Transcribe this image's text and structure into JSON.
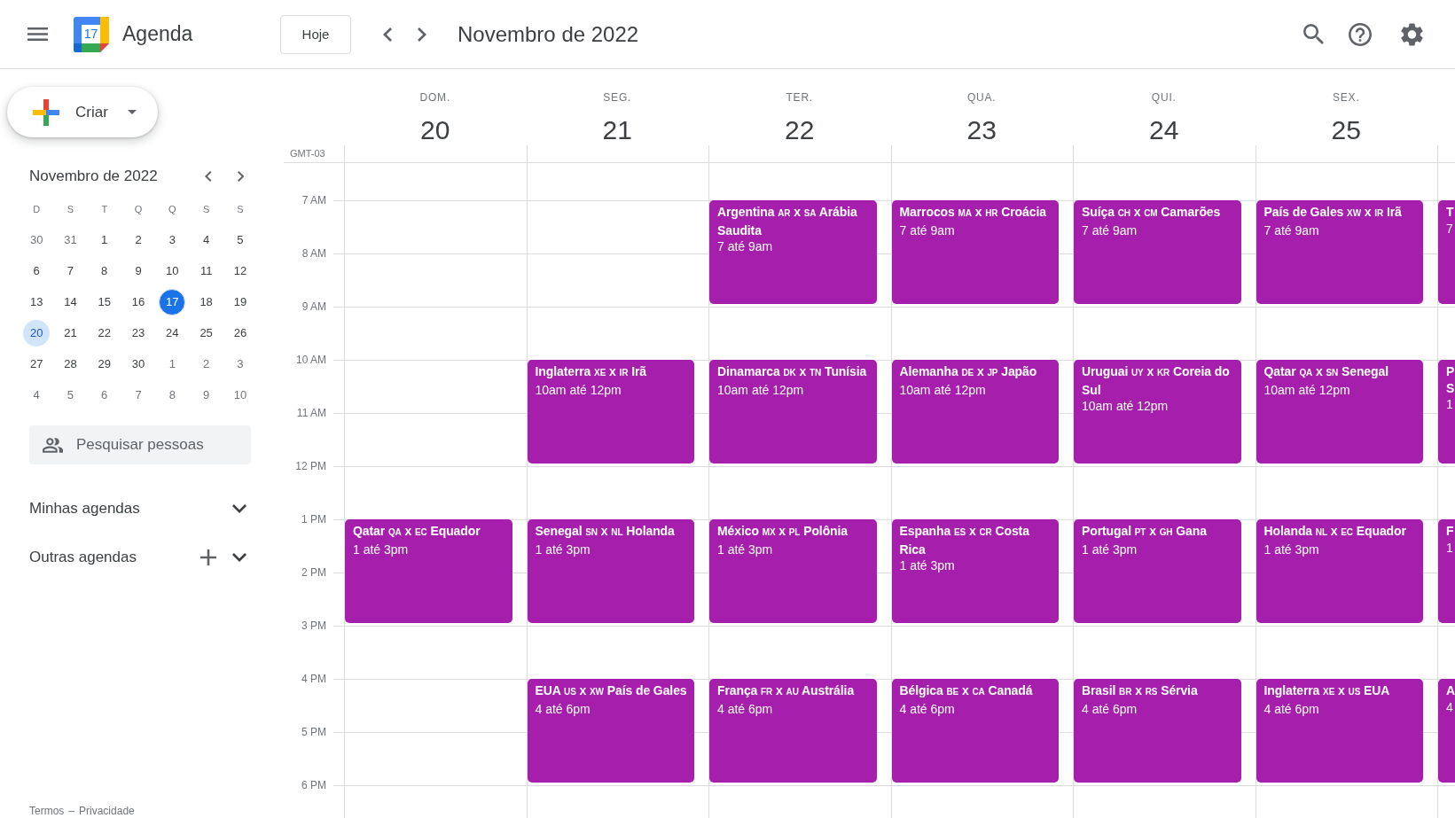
{
  "top_bar": {
    "app": {
      "logo_text": "17",
      "name": "Agenda"
    },
    "today_button": "Hoje",
    "title": "Novembro de 2022"
  },
  "sidebar": {
    "create_button": "Criar",
    "mini_calendar": {
      "title": "Novembro de 2022",
      "weekdays": [
        "D",
        "S",
        "T",
        "Q",
        "Q",
        "S",
        "S"
      ],
      "weeks": [
        [
          {
            "label": "30",
            "outside_month": true,
            "today": false,
            "selected": false
          },
          {
            "label": "31",
            "outside_month": true,
            "today": false,
            "selected": false
          },
          {
            "label": "1",
            "outside_month": false,
            "today": false,
            "selected": false
          },
          {
            "label": "2",
            "outside_month": false,
            "today": false,
            "selected": false
          },
          {
            "label": "3",
            "outside_month": false,
            "today": false,
            "selected": false
          },
          {
            "label": "4",
            "outside_month": false,
            "today": false,
            "selected": false
          },
          {
            "label": "5",
            "outside_month": false,
            "today": false,
            "selected": false
          }
        ],
        [
          {
            "label": "6",
            "outside_month": false,
            "today": false,
            "selected": false
          },
          {
            "label": "7",
            "outside_month": false,
            "today": false,
            "selected": false
          },
          {
            "label": "8",
            "outside_month": false,
            "today": false,
            "selected": false
          },
          {
            "label": "9",
            "outside_month": false,
            "today": false,
            "selected": false
          },
          {
            "label": "10",
            "outside_month": false,
            "today": false,
            "selected": false
          },
          {
            "label": "11",
            "outside_month": false,
            "today": false,
            "selected": false
          },
          {
            "label": "12",
            "outside_month": false,
            "today": false,
            "selected": false
          }
        ],
        [
          {
            "label": "13",
            "outside_month": false,
            "today": false,
            "selected": false
          },
          {
            "label": "14",
            "outside_month": false,
            "today": false,
            "selected": false
          },
          {
            "label": "15",
            "outside_month": false,
            "today": false,
            "selected": false
          },
          {
            "label": "16",
            "outside_month": false,
            "today": false,
            "selected": false
          },
          {
            "label": "17",
            "outside_month": false,
            "today": true,
            "selected": false
          },
          {
            "label": "18",
            "outside_month": false,
            "today": false,
            "selected": false
          },
          {
            "label": "19",
            "outside_month": false,
            "today": false,
            "selected": false
          }
        ],
        [
          {
            "label": "20",
            "outside_month": false,
            "today": false,
            "selected": true
          },
          {
            "label": "21",
            "outside_month": false,
            "today": false,
            "selected": false
          },
          {
            "label": "22",
            "outside_month": false,
            "today": false,
            "selected": false
          },
          {
            "label": "23",
            "outside_month": false,
            "today": false,
            "selected": false
          },
          {
            "label": "24",
            "outside_month": false,
            "today": false,
            "selected": false
          },
          {
            "label": "25",
            "outside_month": false,
            "today": false,
            "selected": false
          },
          {
            "label": "26",
            "outside_month": false,
            "today": false,
            "selected": false
          }
        ],
        [
          {
            "label": "27",
            "outside_month": false,
            "today": false,
            "selected": false
          },
          {
            "label": "28",
            "outside_month": false,
            "today": false,
            "selected": false
          },
          {
            "label": "29",
            "outside_month": false,
            "today": false,
            "selected": false
          },
          {
            "label": "30",
            "outside_month": false,
            "today": false,
            "selected": false
          },
          {
            "label": "1",
            "outside_month": true,
            "today": false,
            "selected": false
          },
          {
            "label": "2",
            "outside_month": true,
            "today": false,
            "selected": false
          },
          {
            "label": "3",
            "outside_month": true,
            "today": false,
            "selected": false
          }
        ],
        [
          {
            "label": "4",
            "outside_month": true,
            "today": false,
            "selected": false
          },
          {
            "label": "5",
            "outside_month": true,
            "today": false,
            "selected": false
          },
          {
            "label": "6",
            "outside_month": true,
            "today": false,
            "selected": false
          },
          {
            "label": "7",
            "outside_month": true,
            "today": false,
            "selected": false
          },
          {
            "label": "8",
            "outside_month": true,
            "today": false,
            "selected": false
          },
          {
            "label": "9",
            "outside_month": true,
            "today": false,
            "selected": false
          },
          {
            "label": "10",
            "outside_month": true,
            "today": false,
            "selected": false
          }
        ]
      ]
    },
    "people_search": {
      "placeholder": "Pesquisar pessoas"
    },
    "calendar_sections": [
      {
        "label": "Minhas agendas",
        "kind": "plain",
        "expanded": false
      },
      {
        "label": "Outras agendas",
        "kind": "addable",
        "expanded": false
      }
    ],
    "footer": {
      "links": [
        "Termos",
        "Privacidade"
      ],
      "separator": "–"
    }
  },
  "week_view": {
    "timezone": "GMT-03",
    "hours": [
      "7 AM",
      "8 AM",
      "9 AM",
      "10 AM",
      "11 AM",
      "12 PM",
      "1 PM",
      "2 PM",
      "3 PM",
      "4 PM",
      "5 PM",
      "6 PM"
    ],
    "days": [
      {
        "name": "DOM.",
        "number": "20",
        "events": [
          {
            "kind": "free"
          },
          {
            "kind": "free"
          },
          {
            "kind": "match",
            "title": [
              {
                "kind": "team",
                "text": "Qatar"
              },
              {
                "kind": "code",
                "text": "QA"
              },
              {
                "kind": "team",
                "text": "x"
              },
              {
                "kind": "code",
                "text": "EC"
              },
              {
                "kind": "team",
                "text": "Equador"
              }
            ],
            "time": "1 até 3pm"
          },
          {
            "kind": "free"
          }
        ]
      },
      {
        "name": "SEG.",
        "number": "21",
        "events": [
          {
            "kind": "free"
          },
          {
            "kind": "match",
            "title": [
              {
                "kind": "team",
                "text": "Inglaterra"
              },
              {
                "kind": "code",
                "text": "XE"
              },
              {
                "kind": "team",
                "text": "x"
              },
              {
                "kind": "code",
                "text": "IR"
              },
              {
                "kind": "team",
                "text": "Irã"
              }
            ],
            "time": "10am até 12pm"
          },
          {
            "kind": "match",
            "title": [
              {
                "kind": "team",
                "text": "Senegal"
              },
              {
                "kind": "code",
                "text": "SN"
              },
              {
                "kind": "team",
                "text": "x"
              },
              {
                "kind": "code",
                "text": "NL"
              },
              {
                "kind": "team",
                "text": "Holanda"
              }
            ],
            "time": "1 até 3pm"
          },
          {
            "kind": "match",
            "title": [
              {
                "kind": "team",
                "text": "EUA"
              },
              {
                "kind": "code",
                "text": "US"
              },
              {
                "kind": "team",
                "text": "x"
              },
              {
                "kind": "code",
                "text": "XW"
              },
              {
                "kind": "team",
                "text": "País de Gales"
              }
            ],
            "time": "4 até 6pm"
          }
        ]
      },
      {
        "name": "TER.",
        "number": "22",
        "events": [
          {
            "kind": "match",
            "title": [
              {
                "kind": "team",
                "text": "Argentina"
              },
              {
                "kind": "code",
                "text": "AR"
              },
              {
                "kind": "team",
                "text": "x"
              },
              {
                "kind": "code",
                "text": "SA"
              },
              {
                "kind": "team",
                "text": "Arábia Saudita"
              }
            ],
            "time": "7 até 9am"
          },
          {
            "kind": "match",
            "title": [
              {
                "kind": "team",
                "text": "Dinamarca"
              },
              {
                "kind": "code",
                "text": "DK"
              },
              {
                "kind": "team",
                "text": "x"
              },
              {
                "kind": "code",
                "text": "TN"
              },
              {
                "kind": "team",
                "text": "Tunísia"
              }
            ],
            "time": "10am até 12pm"
          },
          {
            "kind": "match",
            "title": [
              {
                "kind": "team",
                "text": "México"
              },
              {
                "kind": "code",
                "text": "MX"
              },
              {
                "kind": "team",
                "text": "x"
              },
              {
                "kind": "code",
                "text": "PL"
              },
              {
                "kind": "team",
                "text": "Polônia"
              }
            ],
            "time": "1 até 3pm"
          },
          {
            "kind": "match",
            "title": [
              {
                "kind": "team",
                "text": "França"
              },
              {
                "kind": "code",
                "text": "FR"
              },
              {
                "kind": "team",
                "text": "x"
              },
              {
                "kind": "code",
                "text": "AU"
              },
              {
                "kind": "team",
                "text": "Austrália"
              }
            ],
            "time": "4 até 6pm"
          }
        ]
      },
      {
        "name": "QUA.",
        "number": "23",
        "events": [
          {
            "kind": "match",
            "title": [
              {
                "kind": "team",
                "text": "Marrocos"
              },
              {
                "kind": "code",
                "text": "MA"
              },
              {
                "kind": "team",
                "text": "x"
              },
              {
                "kind": "code",
                "text": "HR"
              },
              {
                "kind": "team",
                "text": "Croácia"
              }
            ],
            "time": "7 até 9am"
          },
          {
            "kind": "match",
            "title": [
              {
                "kind": "team",
                "text": "Alemanha"
              },
              {
                "kind": "code",
                "text": "DE"
              },
              {
                "kind": "team",
                "text": "x"
              },
              {
                "kind": "code",
                "text": "JP"
              },
              {
                "kind": "team",
                "text": "Japão"
              }
            ],
            "time": "10am até 12pm"
          },
          {
            "kind": "match",
            "title": [
              {
                "kind": "team",
                "text": "Espanha"
              },
              {
                "kind": "code",
                "text": "ES"
              },
              {
                "kind": "team",
                "text": "x"
              },
              {
                "kind": "code",
                "text": "CR"
              },
              {
                "kind": "team",
                "text": "Costa Rica"
              }
            ],
            "time": "1 até 3pm"
          },
          {
            "kind": "match",
            "title": [
              {
                "kind": "team",
                "text": "Bélgica"
              },
              {
                "kind": "code",
                "text": "BE"
              },
              {
                "kind": "team",
                "text": "x"
              },
              {
                "kind": "code",
                "text": "CA"
              },
              {
                "kind": "team",
                "text": "Canadá"
              }
            ],
            "time": "4 até 6pm"
          }
        ]
      },
      {
        "name": "QUI.",
        "number": "24",
        "events": [
          {
            "kind": "match",
            "title": [
              {
                "kind": "team",
                "text": "Suíça"
              },
              {
                "kind": "code",
                "text": "CH"
              },
              {
                "kind": "team",
                "text": "x"
              },
              {
                "kind": "code",
                "text": "CM"
              },
              {
                "kind": "team",
                "text": "Camarões"
              }
            ],
            "time": "7 até 9am"
          },
          {
            "kind": "match",
            "title": [
              {
                "kind": "team",
                "text": "Uruguai"
              },
              {
                "kind": "code",
                "text": "UY"
              },
              {
                "kind": "team",
                "text": "x"
              },
              {
                "kind": "code",
                "text": "KR"
              },
              {
                "kind": "team",
                "text": "Coreia do Sul"
              }
            ],
            "time": "10am até 12pm"
          },
          {
            "kind": "match",
            "title": [
              {
                "kind": "team",
                "text": "Portugal"
              },
              {
                "kind": "code",
                "text": "PT"
              },
              {
                "kind": "team",
                "text": "x"
              },
              {
                "kind": "code",
                "text": "GH"
              },
              {
                "kind": "team",
                "text": "Gana"
              }
            ],
            "time": "1 até 3pm"
          },
          {
            "kind": "match",
            "title": [
              {
                "kind": "team",
                "text": "Brasil"
              },
              {
                "kind": "code",
                "text": "BR"
              },
              {
                "kind": "team",
                "text": "x"
              },
              {
                "kind": "code",
                "text": "RS"
              },
              {
                "kind": "team",
                "text": "Sérvia"
              }
            ],
            "time": "4 até 6pm"
          }
        ]
      },
      {
        "name": "SEX.",
        "number": "25",
        "events": [
          {
            "kind": "match",
            "title": [
              {
                "kind": "team",
                "text": "País de Gales"
              },
              {
                "kind": "code",
                "text": "XW"
              },
              {
                "kind": "team",
                "text": "x"
              },
              {
                "kind": "code",
                "text": "IR"
              },
              {
                "kind": "team",
                "text": "Irã"
              }
            ],
            "time": "7 até 9am"
          },
          {
            "kind": "match",
            "title": [
              {
                "kind": "team",
                "text": "Qatar"
              },
              {
                "kind": "code",
                "text": "QA"
              },
              {
                "kind": "team",
                "text": "x"
              },
              {
                "kind": "code",
                "text": "SN"
              },
              {
                "kind": "team",
                "text": "Senegal"
              }
            ],
            "time": "10am até 12pm"
          },
          {
            "kind": "match",
            "title": [
              {
                "kind": "team",
                "text": "Holanda"
              },
              {
                "kind": "code",
                "text": "NL"
              },
              {
                "kind": "team",
                "text": "x"
              },
              {
                "kind": "code",
                "text": "EC"
              },
              {
                "kind": "team",
                "text": "Equador"
              }
            ],
            "time": "1 até 3pm"
          },
          {
            "kind": "match",
            "title": [
              {
                "kind": "team",
                "text": "Inglaterra"
              },
              {
                "kind": "code",
                "text": "XE"
              },
              {
                "kind": "team",
                "text": "x"
              },
              {
                "kind": "code",
                "text": "US"
              },
              {
                "kind": "team",
                "text": "EUA"
              }
            ],
            "time": "4 até 6pm"
          }
        ]
      },
      {
        "events": [
          {
            "kind": "match",
            "title": [
              {
                "kind": "team",
                "text": "T"
              }
            ],
            "time": "7"
          },
          {
            "kind": "match",
            "title": [
              {
                "kind": "team",
                "text": "P"
              },
              {
                "kind": "team",
                "text": "S"
              }
            ],
            "time": "1"
          },
          {
            "kind": "match",
            "title": [
              {
                "kind": "team",
                "text": "F"
              }
            ],
            "time": "1"
          },
          {
            "kind": "match",
            "title": [
              {
                "kind": "team",
                "text": "A"
              }
            ],
            "time": "4"
          }
        ]
      }
    ]
  }
}
